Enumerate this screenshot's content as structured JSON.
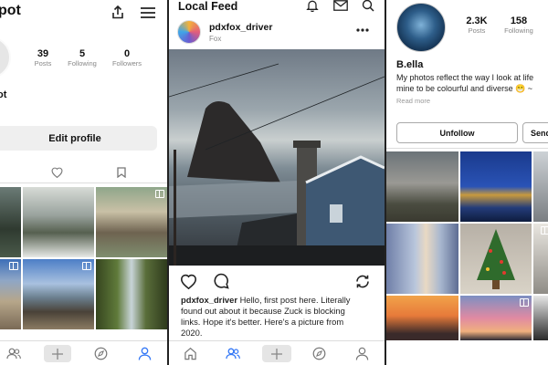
{
  "left": {
    "title": "pot",
    "name_fragment": "ot",
    "stats": [
      {
        "num": "39",
        "label": "Posts"
      },
      {
        "num": "5",
        "label": "Following"
      },
      {
        "num": "0",
        "label": "Followers"
      }
    ],
    "edit_profile_label": "Edit profile",
    "icons": {
      "share": "share-icon",
      "menu": "hamburger-menu-icon",
      "heart": "heart-icon",
      "bookmark": "bookmark-icon"
    }
  },
  "center": {
    "title": "Local Feed",
    "post": {
      "username": "pdxfox_driver",
      "subtitle": "Fox",
      "caption_user": "pdxfox_driver",
      "caption_lines": [
        "Hello, first post here. Literally",
        "found out about it because Zuck is blocking",
        "links. Hope it's better. Here's a picture from",
        "2020."
      ]
    },
    "icons": {
      "bell": "bell-icon",
      "mail": "mail-icon",
      "search": "search-icon",
      "more": "more-dots-icon",
      "like": "heart-icon",
      "comment": "comment-icon",
      "repost": "repost-icon"
    }
  },
  "right": {
    "stats": [
      {
        "num": "2.3K",
        "label": "Posts"
      },
      {
        "num": "158",
        "label": "Following"
      }
    ],
    "username": "B.ella",
    "bio_line1": "My photos reflect the way I look at life",
    "bio_line2": "mine to be colourful and diverse 😁 ~",
    "read_more": "Read more",
    "unfollow_label": "Unfollow",
    "send_label": "Send"
  },
  "nav": {
    "items": [
      "people-icon",
      "add-icon",
      "explore-compass-icon",
      "profile-icon"
    ],
    "home": "home-icon"
  },
  "colors": {
    "accent": "#3478f6",
    "button_bg": "#efefef",
    "muted": "#888888"
  }
}
